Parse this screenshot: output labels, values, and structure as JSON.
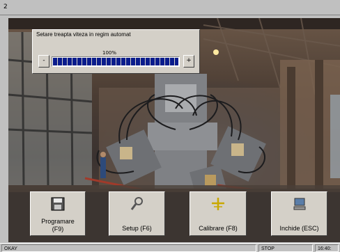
{
  "window": {
    "title": "2"
  },
  "speed_panel": {
    "title": "Setare treapta viteza in regim automat",
    "value_text": "100%",
    "progress_fraction": 1.0,
    "minus_label": "-",
    "plus_label": "+"
  },
  "function_buttons": [
    {
      "line1": "Programare",
      "line2": "(F9)",
      "icon": "floppy-disk-icon"
    },
    {
      "line1": "Setup  (F6)",
      "line2": "",
      "icon": "wrench-icon"
    },
    {
      "line1": "Calibrare (F8)",
      "line2": "",
      "icon": "crosshair-icon"
    },
    {
      "line1": "Inchide (ESC)",
      "line2": "",
      "icon": "computer-icon"
    }
  ],
  "status_bar": {
    "left": "OKAY",
    "state": "STOP",
    "time": "16:40:"
  },
  "colors": {
    "progress": "#0a1c8c",
    "panel": "#d4d0c8"
  }
}
